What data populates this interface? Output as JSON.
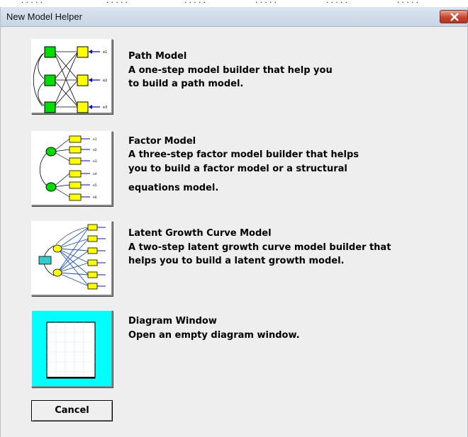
{
  "window": {
    "title": "New Model Helper"
  },
  "options": [
    {
      "title": "Path Model",
      "desc": [
        "A one-step model builder that help you",
        "to build a path model."
      ]
    },
    {
      "title": "Factor Model",
      "desc": [
        "A three-step factor model builder that helps",
        "you to build a factor model or a structural",
        "equations model."
      ]
    },
    {
      "title": "Latent Growth Curve Model",
      "desc": [
        "A two-step latent growth curve model builder that",
        "helps you to build a latent growth model."
      ]
    },
    {
      "title": "Diagram Window",
      "desc": [
        "Open an empty diagram window."
      ]
    }
  ],
  "buttons": {
    "cancel": "Cancel"
  },
  "colors": {
    "observed": "#ffff00",
    "exogenous": "#00dd00",
    "arrow": "#0000cc",
    "diagram_bg": "#00ffff",
    "close": "#c9452f"
  }
}
